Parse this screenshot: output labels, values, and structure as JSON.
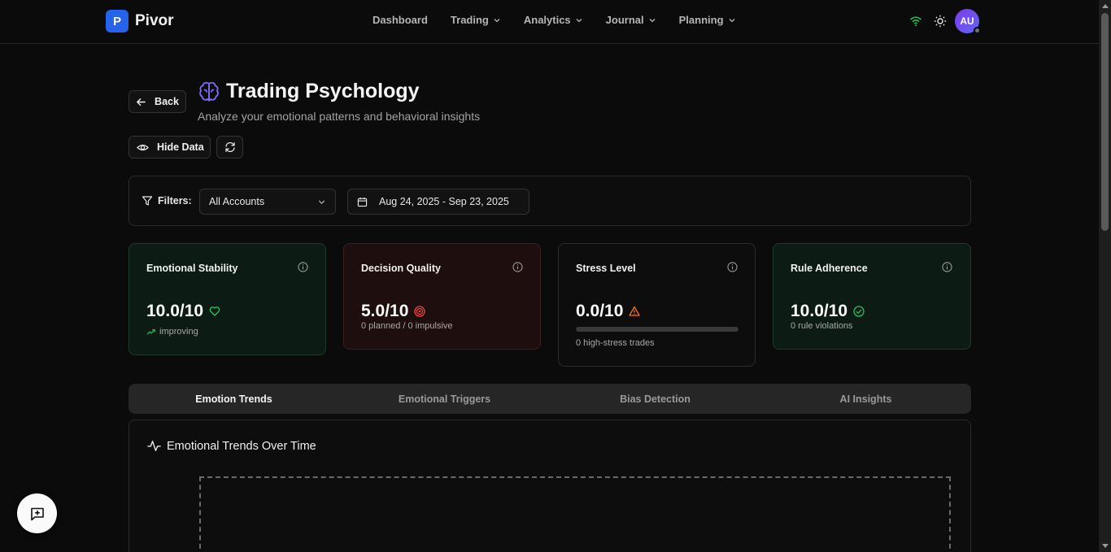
{
  "brand": {
    "logo_letter": "P",
    "name": "Pivor",
    "accent": "#2563eb"
  },
  "nav": {
    "items": [
      {
        "label": "Dashboard",
        "dropdown": false
      },
      {
        "label": "Trading",
        "dropdown": true
      },
      {
        "label": "Analytics",
        "dropdown": true
      },
      {
        "label": "Journal",
        "dropdown": true
      },
      {
        "label": "Planning",
        "dropdown": true
      }
    ],
    "avatar_initials": "AU",
    "status_icon": "wifi-icon",
    "theme_icon": "sun-icon"
  },
  "header": {
    "back_label": "Back",
    "title": "Trading Psychology",
    "subtitle": "Analyze your emotional patterns and behavioral insights",
    "title_icon": "brain-icon",
    "hide_data_label": "Hide Data"
  },
  "filters": {
    "label": "Filters:",
    "account_value": "All Accounts",
    "date_range_value": "Aug 24, 2025 - Sep 23, 2025"
  },
  "metrics": {
    "emotional_stability": {
      "title": "Emotional Stability",
      "value": "10.0/10",
      "sub": "improving",
      "status_color": "#22c55e"
    },
    "decision_quality": {
      "title": "Decision Quality",
      "value": "5.0/10",
      "sub": "0 planned / 0 impulsive",
      "status_color": "#ef4444"
    },
    "stress_level": {
      "title": "Stress Level",
      "value": "0.0/10",
      "sub": "0 high-stress trades",
      "progress": 0,
      "status_color": "#f97316"
    },
    "rule_adherence": {
      "title": "Rule Adherence",
      "value": "10.0/10",
      "sub": "0 rule violations",
      "status_color": "#22c55e"
    }
  },
  "tabs": [
    {
      "label": "Emotion Trends",
      "active": true
    },
    {
      "label": "Emotional Triggers",
      "active": false
    },
    {
      "label": "Bias Detection",
      "active": false
    },
    {
      "label": "AI Insights",
      "active": false
    }
  ],
  "trends_panel": {
    "title": "Emotional Trends Over Time"
  }
}
